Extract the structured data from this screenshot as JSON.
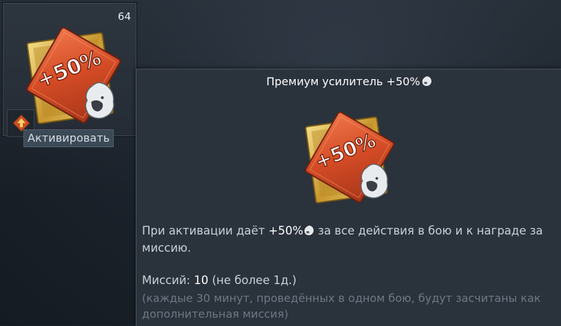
{
  "slot": {
    "count": "64",
    "activate_label": "Активировать",
    "icon": "premium-booster-50-icon",
    "upgrade_icon": "upgrade-arrow-icon"
  },
  "tooltip": {
    "title": "Премиум усилитель +50%",
    "desc_prefix": "При активации даёт ",
    "desc_value": "+50%",
    "desc_suffix": " за все действия в бою и к награде за миссию.",
    "missions_label": "Миссий: ",
    "missions_value": "10",
    "missions_limit": " (не более 1д.)",
    "note": "(каждые 30 минут, проведённых в одном бою, будут засчитаны как дополнительная миссия)",
    "booster_text": "+50%"
  },
  "colors": {
    "tooltip_bg": "#2a323c",
    "booster_red": "#d9532a",
    "booster_gold": "#d8b24a",
    "text_muted": "#6e7883"
  }
}
